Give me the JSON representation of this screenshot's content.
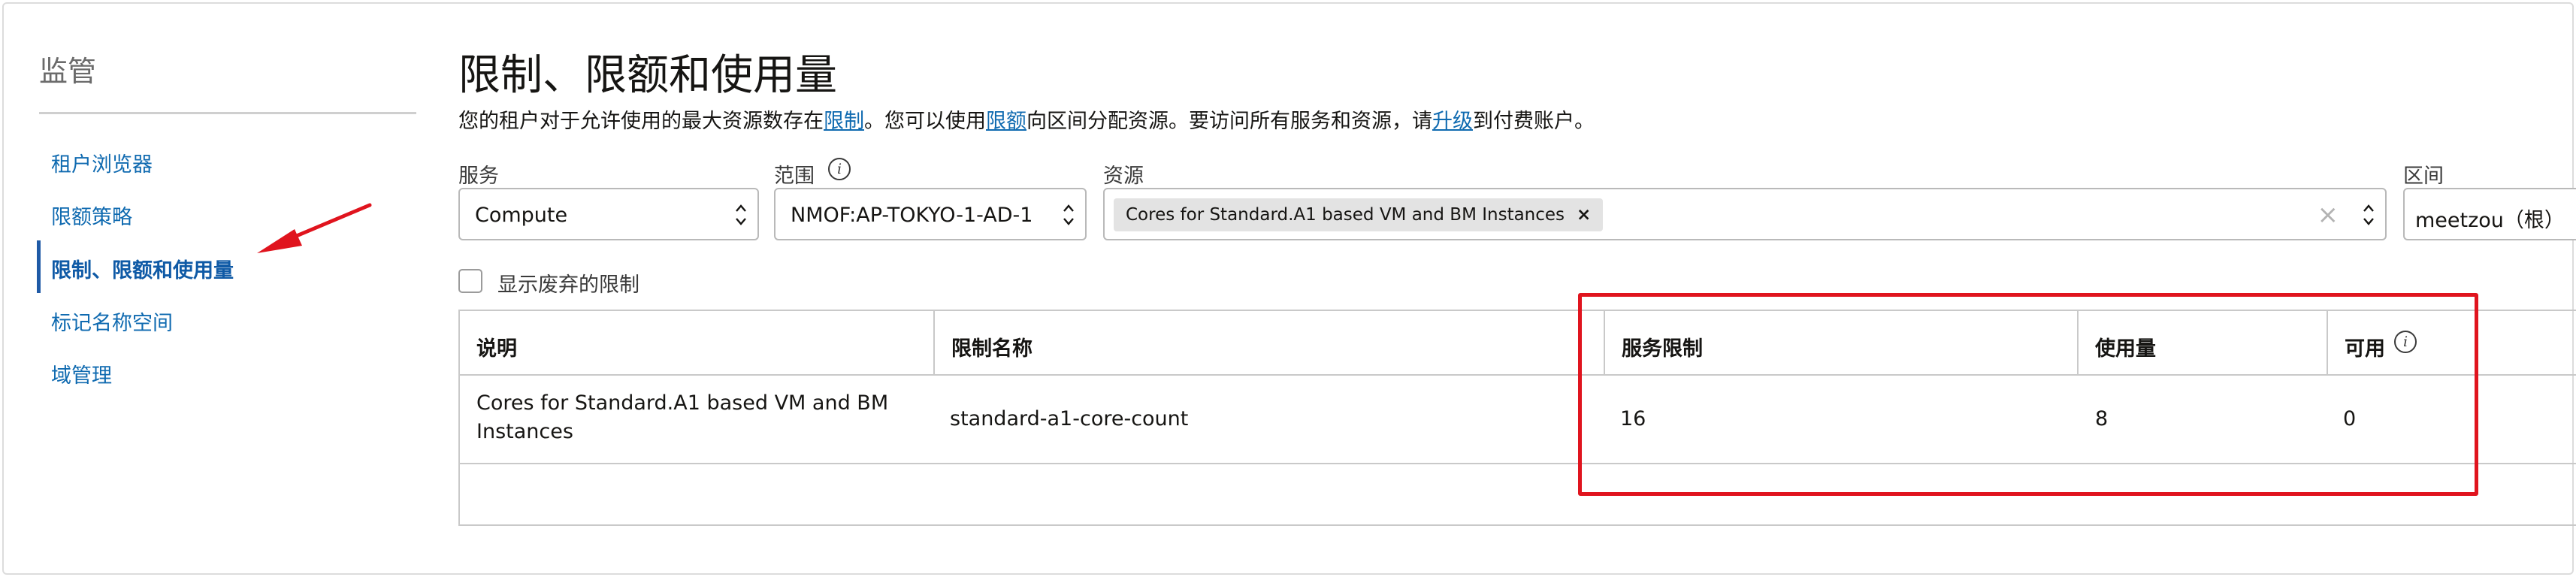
{
  "sidebar": {
    "title": "监管",
    "items": [
      {
        "label": "租户浏览器"
      },
      {
        "label": "限额策略"
      },
      {
        "label": "限制、限额和使用量"
      },
      {
        "label": "标记名称空间"
      },
      {
        "label": "域管理"
      }
    ],
    "active_index": 2
  },
  "main": {
    "title": "限制、限额和使用量",
    "description": {
      "part1": "您的租户对于允许使用的最大资源数存在",
      "link1": "限制",
      "part2": "。您可以使用",
      "link2": "限额",
      "part3": "向区间分配资源。要访问所有服务和资源，请",
      "link3": "升级",
      "part4": "到付费账户。"
    },
    "filters": {
      "service": {
        "label": "服务",
        "value": "Compute"
      },
      "scope": {
        "label": "范围",
        "value": "NMOF:AP-TOKYO-1-AD-1",
        "info_icon": "info-icon"
      },
      "resource": {
        "label": "资源",
        "chip": "Cores for Standard.A1 based VM and BM Instances",
        "chip_remove": "×",
        "clear": "×"
      },
      "compartment": {
        "label": "区间",
        "value": "meetzou（根）"
      }
    },
    "deprecated_checkbox": {
      "label": "显示废弃的限制",
      "checked": false
    },
    "table": {
      "headers": [
        "说明",
        "限制名称",
        "服务限制",
        "使用量",
        "可用"
      ],
      "available_info_icon": "info-icon",
      "rows": [
        {
          "description": "Cores for Standard.A1 based VM and BM Instances",
          "limit_name": "standard-a1-core-count",
          "service_limit": "16",
          "usage": "8",
          "available": "0"
        }
      ]
    }
  },
  "annotations": {
    "highlight_color": "#e0141e",
    "arrow_color": "#e0141e"
  }
}
